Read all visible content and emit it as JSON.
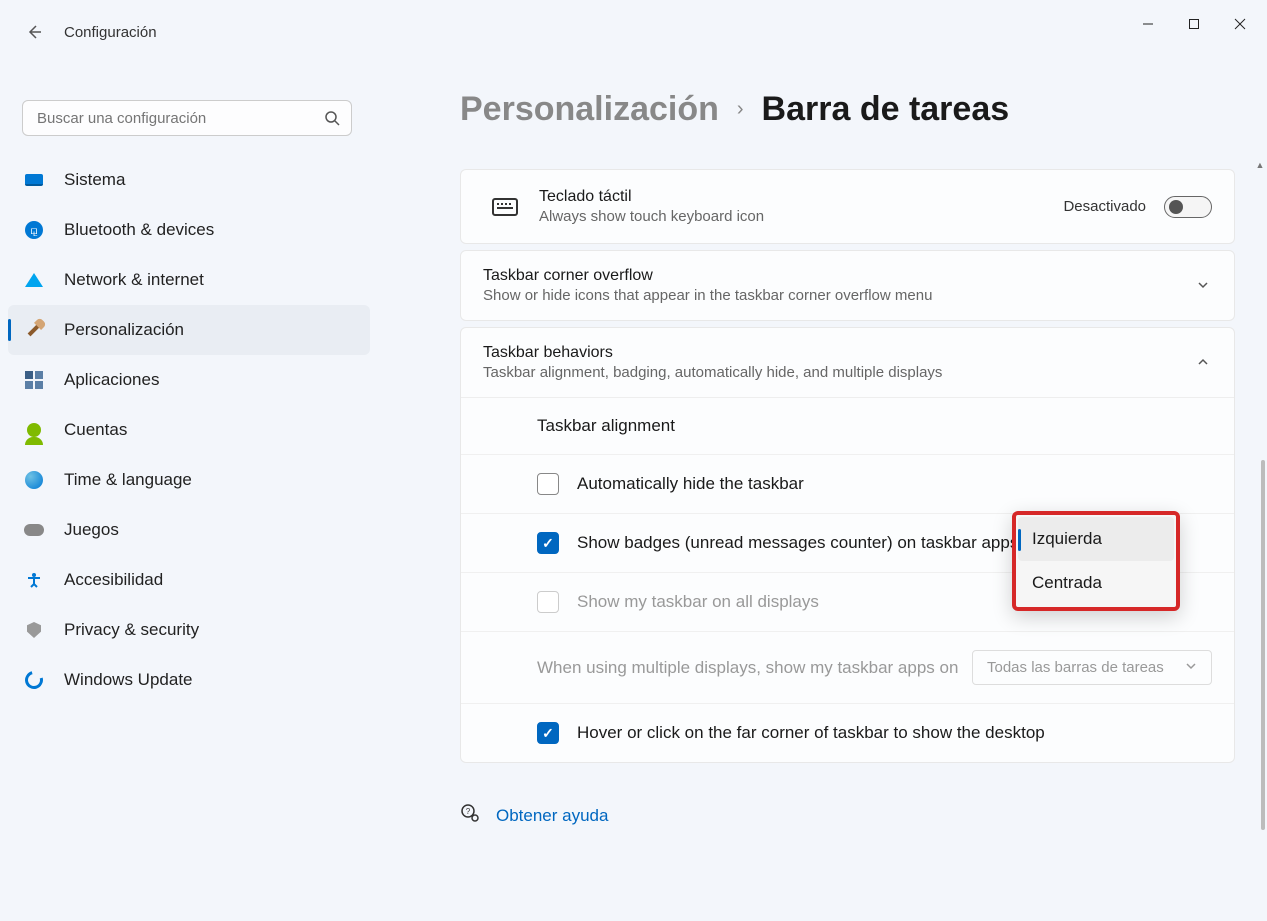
{
  "app_title": "Configuración",
  "search": {
    "placeholder": "Buscar una configuración"
  },
  "nav": {
    "items": [
      {
        "label": "Sistema"
      },
      {
        "label": "Bluetooth & devices"
      },
      {
        "label": "Network & internet"
      },
      {
        "label": "Personalización"
      },
      {
        "label": "Aplicaciones"
      },
      {
        "label": "Cuentas"
      },
      {
        "label": "Time & language"
      },
      {
        "label": "Juegos"
      },
      {
        "label": "Accesibilidad"
      },
      {
        "label": "Privacy & security"
      },
      {
        "label": "Windows Update"
      }
    ]
  },
  "breadcrumb": {
    "parent": "Personalización",
    "current": "Barra de tareas"
  },
  "cards": {
    "touch_kb": {
      "title": "Teclado táctil",
      "sub": "Always show touch keyboard icon",
      "toggle_label": "Desactivado",
      "toggle_state": false
    },
    "overflow": {
      "title": "Taskbar corner overflow",
      "sub": "Show or hide icons that appear in the taskbar corner overflow menu"
    },
    "behaviors": {
      "title": "Taskbar behaviors",
      "sub": "Taskbar alignment, badging, automatically hide, and multiple displays"
    }
  },
  "behaviors": {
    "alignment": {
      "label": "Taskbar alignment",
      "options": [
        "Izquierda",
        "Centrada"
      ],
      "selected": "Izquierda"
    },
    "auto_hide": {
      "label": "Automatically hide the taskbar",
      "checked": false
    },
    "badges": {
      "label": "Show badges (unread messages counter) on taskbar apps",
      "checked": true
    },
    "all_displays": {
      "label": "Show my taskbar on all displays",
      "checked": false,
      "disabled": true
    },
    "multi_show": {
      "label": "When using multiple displays, show my taskbar apps on",
      "select_value": "Todas las barras de tareas",
      "disabled": true
    },
    "hover_corner": {
      "label": "Hover or click on the far corner of taskbar to show the desktop",
      "checked": true
    }
  },
  "help": {
    "label": "Obtener ayuda"
  }
}
